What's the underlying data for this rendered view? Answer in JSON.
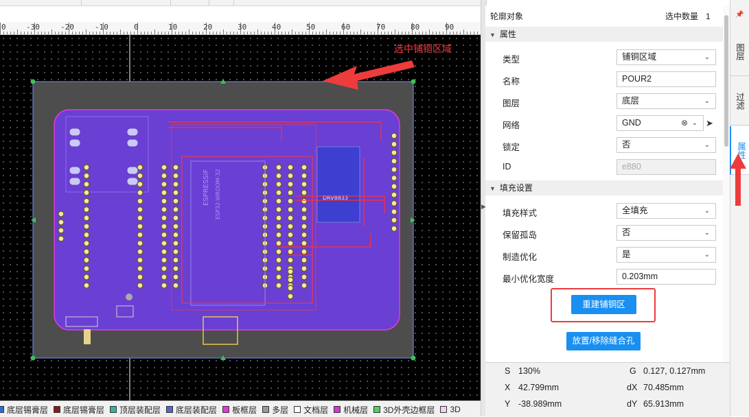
{
  "ruler": {
    "labels": [
      "0",
      "-30",
      "-20",
      "-10",
      "0",
      "10",
      "20",
      "30",
      "40",
      "50",
      "60",
      "70",
      "80",
      "90"
    ]
  },
  "annotation": {
    "callout": "选中铺铜区域"
  },
  "layers": [
    {
      "name": "底层锡膏层",
      "color": "#2e6dd6"
    },
    {
      "name": "底层锡膏层",
      "color": "#8a1a1a"
    },
    {
      "name": "顶层装配层",
      "color": "#35b3a1"
    },
    {
      "name": "底层装配层",
      "color": "#5566cc"
    },
    {
      "name": "板框层",
      "color": "#e23ad6"
    },
    {
      "name": "多层",
      "color": "#9a9a9a"
    },
    {
      "name": "文档层",
      "color": "#ffffff"
    },
    {
      "name": "机械层",
      "color": "#d935d9"
    },
    {
      "name": "3D外壳边框层",
      "color": "#55cc66"
    },
    {
      "name": "3D",
      "color": "#f2d0f2"
    }
  ],
  "panel": {
    "title": "轮廓对象",
    "selected_label": "选中数量",
    "selected_count": "1",
    "section_props": "属性",
    "fields": [
      {
        "label": "类型",
        "value": "铺铜区域",
        "kind": "select"
      },
      {
        "label": "名称",
        "value": "POUR2",
        "kind": "input"
      },
      {
        "label": "图层",
        "value": "底层",
        "kind": "select"
      },
      {
        "label": "网络",
        "value": "GND",
        "kind": "net"
      },
      {
        "label": "锁定",
        "value": "否",
        "kind": "select"
      },
      {
        "label": "ID",
        "value": "e880",
        "kind": "disabled"
      }
    ],
    "section_fill": "填充设置",
    "fill_fields": [
      {
        "label": "填充样式",
        "value": "全填充",
        "kind": "select"
      },
      {
        "label": "保留孤岛",
        "value": "否",
        "kind": "select"
      },
      {
        "label": "制造优化",
        "value": "是",
        "kind": "select"
      },
      {
        "label": "最小优化宽度",
        "value": "0.203mm",
        "kind": "input"
      }
    ],
    "rebuild_button": "重建铺铜区",
    "stitch_button": "放置/移除缝合孔"
  },
  "tabs": [
    {
      "label": "图层",
      "active": false
    },
    {
      "label": "过滤",
      "active": false
    },
    {
      "label": "属性",
      "active": true
    }
  ],
  "status": {
    "s_label": "S",
    "s_value": "130%",
    "g_label": "G",
    "g_value": "0.127, 0.127mm",
    "x_label": "X",
    "x_value": "42.799mm",
    "dx_label": "dX",
    "dx_value": "70.485mm",
    "y_label": "Y",
    "y_value": "-38.989mm",
    "dy_label": "dY",
    "dy_value": "65.913mm"
  },
  "board": {
    "chip_text_1": "ESPRESSIF",
    "chip_text_2": "ESP32-WROOM-32",
    "module_text": "DRV8833"
  },
  "colors": {
    "accent": "#1a8ff2",
    "annotation": "#ee3b3b",
    "pour": "#6a3fd4",
    "outline": "#e23ad6"
  }
}
